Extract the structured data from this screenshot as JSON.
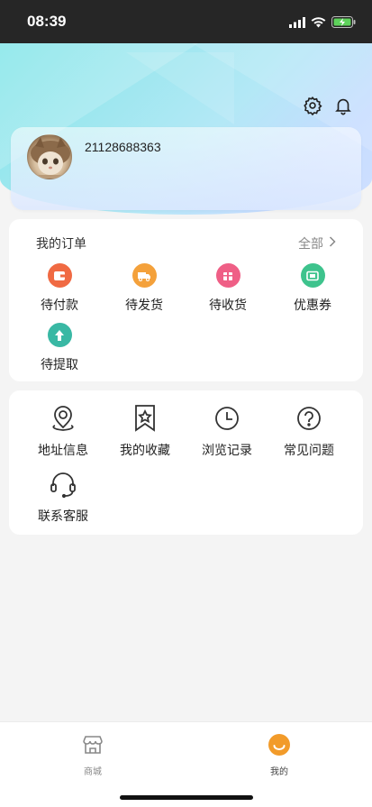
{
  "status_bar": {
    "time": "08:39"
  },
  "header": {
    "settings_icon": "gear-icon",
    "notification_icon": "bell-icon"
  },
  "profile": {
    "username": "21128688363"
  },
  "orders": {
    "title": "我的订单",
    "view_all": "全部",
    "items": [
      {
        "label": "待付款",
        "icon": "wallet-icon",
        "color": "#f06a43"
      },
      {
        "label": "待发货",
        "icon": "truck-icon",
        "color": "#f4a13b"
      },
      {
        "label": "待收货",
        "icon": "package-icon",
        "color": "#ef5f86"
      },
      {
        "label": "优惠券",
        "icon": "coupon-icon",
        "color": "#3ec38d"
      },
      {
        "label": "待提取",
        "icon": "pickup-icon",
        "color": "#39b8a4"
      }
    ]
  },
  "tools": {
    "items": [
      {
        "label": "地址信息",
        "icon": "location-pin-icon"
      },
      {
        "label": "我的收藏",
        "icon": "bookmark-star-icon"
      },
      {
        "label": "浏览记录",
        "icon": "clock-icon"
      },
      {
        "label": "常见问题",
        "icon": "question-icon"
      },
      {
        "label": "联系客服",
        "icon": "headset-icon"
      }
    ]
  },
  "tabbar": {
    "items": [
      {
        "label": "商城",
        "icon": "store-icon",
        "active": false
      },
      {
        "label": "我的",
        "icon": "smile-icon",
        "active": true,
        "color": "#f29b2a"
      }
    ]
  }
}
